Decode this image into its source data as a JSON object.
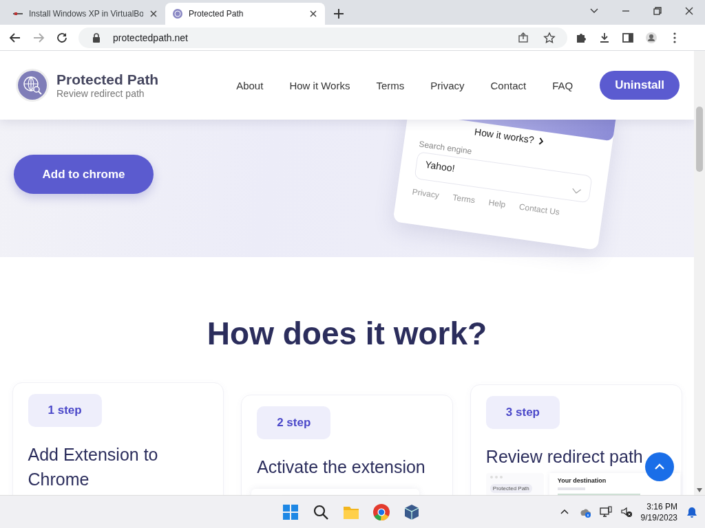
{
  "browser": {
    "tabs": [
      {
        "title": "Install Windows XP in VirtualBo",
        "selected": false
      },
      {
        "title": "Protected Path",
        "selected": true
      }
    ],
    "url": "protectedpath.net"
  },
  "header": {
    "brand": "Protected Path",
    "tagline": "Review redirect path",
    "nav": [
      "About",
      "How it Works",
      "Terms",
      "Privacy",
      "Contact",
      "FAQ"
    ],
    "cta": "Uninstall"
  },
  "hero": {
    "button": "Add to chrome",
    "mockup": {
      "link": "How it works?",
      "field_label": "Search engine",
      "field_value": "Yahoo!",
      "footer_links": [
        "Privacy",
        "Terms",
        "Help",
        "Contact Us"
      ]
    }
  },
  "section": {
    "title": "How does it work?",
    "steps": [
      {
        "badge": "1 step",
        "title": "Add Extension to Chrome",
        "kind": "plain"
      },
      {
        "badge": "2 step",
        "title": "Activate the extension",
        "kind": "popup"
      },
      {
        "badge": "3 step",
        "title": "Review redirect path",
        "kind": "screen",
        "preview_brand": "Protected Path",
        "preview_heading": "Your destination"
      }
    ]
  },
  "taskbar": {
    "time": "3:16 PM",
    "date": "9/19/2023"
  }
}
